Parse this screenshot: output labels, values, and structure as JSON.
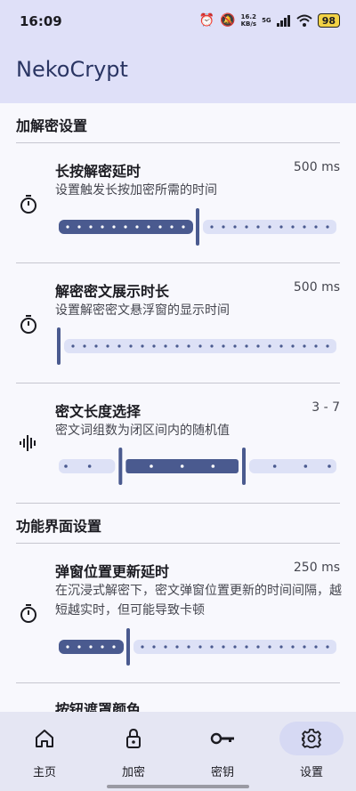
{
  "status": {
    "time": "16:09",
    "net_speed_value": "16.2",
    "net_speed_unit": "KB/s",
    "network": "5G",
    "battery": "98"
  },
  "app": {
    "title": "NekoCrypt"
  },
  "sections": {
    "crypto": {
      "title": "加解密设置"
    },
    "ui": {
      "title": "功能界面设置"
    }
  },
  "prefs": {
    "long_press": {
      "title": "长按解密延时",
      "value": "500 ms",
      "summary": "设置触发长按加密所需的时间",
      "icon": "timer-icon",
      "fraction": 0.5
    },
    "display": {
      "title": "解密密文展示时长",
      "value": "500 ms",
      "summary": "设置解密密文悬浮窗的显示时间",
      "icon": "timer-icon",
      "fraction": 0.0
    },
    "length": {
      "title": "密文长度选择",
      "value": "3 - 7",
      "summary": "密文词组数为闭区间内的随机值",
      "icon": "waveform-icon",
      "range": [
        3,
        7
      ]
    },
    "popup_delay": {
      "title": "弹窗位置更新延时",
      "value": "250 ms",
      "summary": "在沉浸式解密下，密文弹窗位置更新的时间间隔，越短越实时，但可能导致卡顿",
      "icon": "timer-icon",
      "fraction": 0.25
    },
    "mask_color": {
      "title": "按钮遮罩颜色"
    }
  },
  "nav": [
    {
      "label": "主页",
      "icon": "home-icon",
      "active": false
    },
    {
      "label": "加密",
      "icon": "lock-icon",
      "active": false
    },
    {
      "label": "密钥",
      "icon": "key-icon",
      "active": false
    },
    {
      "label": "设置",
      "icon": "gear-icon",
      "active": true
    }
  ],
  "colors": {
    "accent": "#4a5a8f",
    "track_inactive": "#dde1f6",
    "app_bar": "#dfe0f8",
    "nav_bar": "#e5e6f3",
    "active_pill": "#d6d9f3"
  }
}
